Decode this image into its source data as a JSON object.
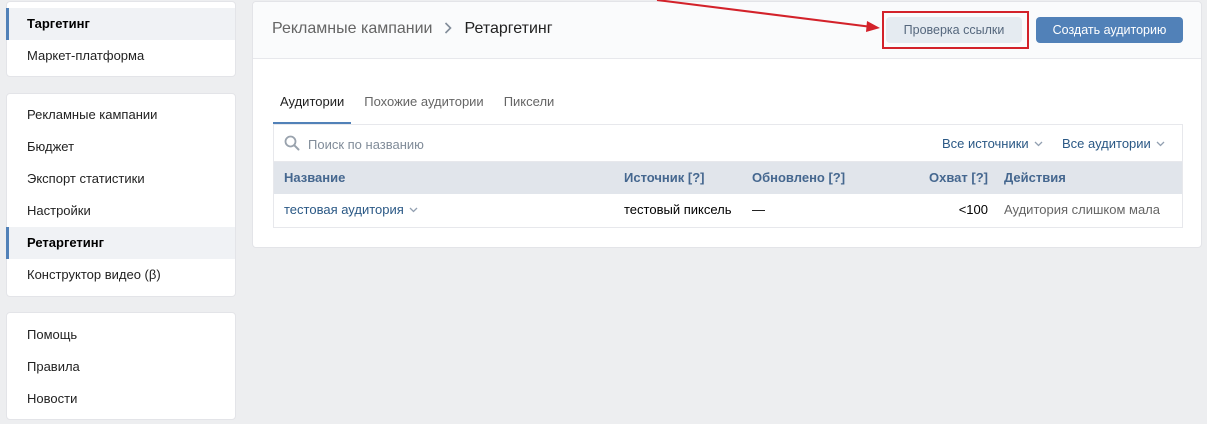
{
  "sidebar": {
    "group1": [
      {
        "label": "Таргетинг",
        "active": true
      },
      {
        "label": "Маркет-платформа",
        "active": false
      }
    ],
    "group2": [
      {
        "label": "Рекламные кампании"
      },
      {
        "label": "Бюджет"
      },
      {
        "label": "Экспорт статистики"
      },
      {
        "label": "Настройки"
      },
      {
        "label": "Ретаргетинг",
        "active": true
      },
      {
        "label": "Конструктор видео (β)"
      }
    ],
    "group3": [
      {
        "label": "Помощь"
      },
      {
        "label": "Правила"
      },
      {
        "label": "Новости"
      }
    ]
  },
  "header": {
    "breadcrumb_parent": "Рекламные кампании",
    "breadcrumb_current": "Ретаргетинг",
    "check_link_button": "Проверка ссылки",
    "create_audience_button": "Создать аудиторию"
  },
  "tabs": [
    {
      "label": "Аудитории",
      "active": true
    },
    {
      "label": "Похожие аудитории"
    },
    {
      "label": "Пиксели"
    }
  ],
  "search": {
    "placeholder": "Поиск по названию",
    "value": ""
  },
  "filters": {
    "sources": "Все источники",
    "audiences": "Все аудитории"
  },
  "table": {
    "columns": {
      "name": "Название",
      "source": "Источник [?]",
      "updated": "Обновлено [?]",
      "reach": "Охват [?]",
      "actions": "Действия"
    },
    "rows": [
      {
        "name": "тестовая аудитория",
        "source": "тестовый пиксель",
        "updated": "—",
        "reach": "<100",
        "actions": "Аудитория слишком мала"
      }
    ]
  },
  "colors": {
    "accent": "#5181b8",
    "link": "#2a5885",
    "highlight": "#d3222a"
  }
}
